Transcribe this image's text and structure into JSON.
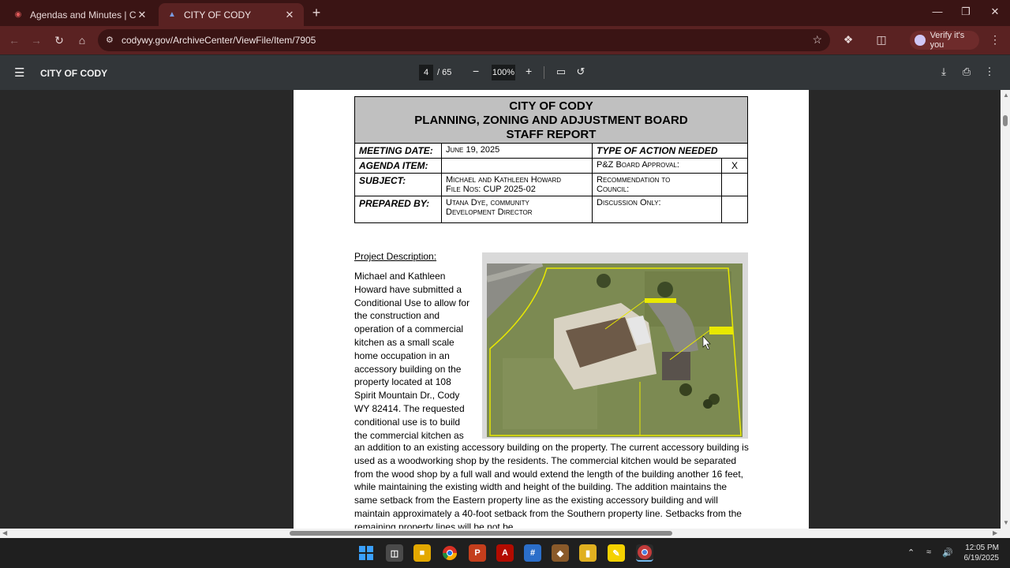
{
  "browser": {
    "tabs": [
      {
        "title": "Agendas and Minutes | Cody, W",
        "active": false
      },
      {
        "title": "CITY OF CODY",
        "active": true
      }
    ],
    "url": "codywy.gov/ArchiveCenter/ViewFile/Item/7905",
    "profile_label": "Verify it's you"
  },
  "pdf_toolbar": {
    "title": "CITY OF CODY",
    "current_page": "4",
    "total_pages": "/ 65",
    "zoom": "100%"
  },
  "report": {
    "header": {
      "line1": "CITY OF CODY",
      "line2": "PLANNING, ZONING AND ADJUSTMENT BOARD",
      "line3": "STAFF REPORT"
    },
    "meeting_date_label": "MEETING DATE:",
    "meeting_date": "June 19, 2025",
    "action_needed_label": "TYPE OF ACTION NEEDED",
    "agenda_item_label": "AGENDA ITEM:",
    "agenda_item": "",
    "pz_approval_label": "P&Z Board Approval:",
    "pz_approval_mark": "X",
    "subject_label": "SUBJECT:",
    "subject_line1": "Michael and Kathleen Howard",
    "subject_line2": "File Nos:  CUP 2025-02",
    "recommendation_label_1": "Recommendation to",
    "recommendation_label_2": "Council:",
    "prepared_by_label": "PREPARED BY:",
    "prepared_by_line1": "Utana Dye, community",
    "prepared_by_line2": "Development Director",
    "discussion_label": "Discussion Only:"
  },
  "project": {
    "section_title": "Project Description:",
    "text_left": "Michael and Kathleen Howard have submitted a Conditional Use to allow for the construction and operation of a commercial kitchen as a small scale home occupation in an accessory building on the property located at 108 Spirit Mountain Dr., Cody WY 82414. The requested conditional use is to build the commercial kitchen as",
    "text_full": "an addition to an existing accessory building on the property. The current accessory building is used as a woodworking shop by the residents. The commercial kitchen would be separated from the wood shop by a full wall and would extend the length of the building another 16 feet, while maintaining the existing width and height of the building. The addition maintains the same setback from the Eastern property line as the existing accessory building and will maintain approximately a 40-foot setback from the Southern property line. Setbacks from the remaining property lines will be not be"
  },
  "taskbar": {
    "time": "12:05 PM",
    "date": "6/19/2025"
  },
  "colors": {
    "tab_strip": "#3a1414",
    "toolbar": "#5a2222",
    "pdf_toolbar": "#323639",
    "report_header_bg": "#c0c0c0",
    "parcel_outline": "#e8e800"
  }
}
